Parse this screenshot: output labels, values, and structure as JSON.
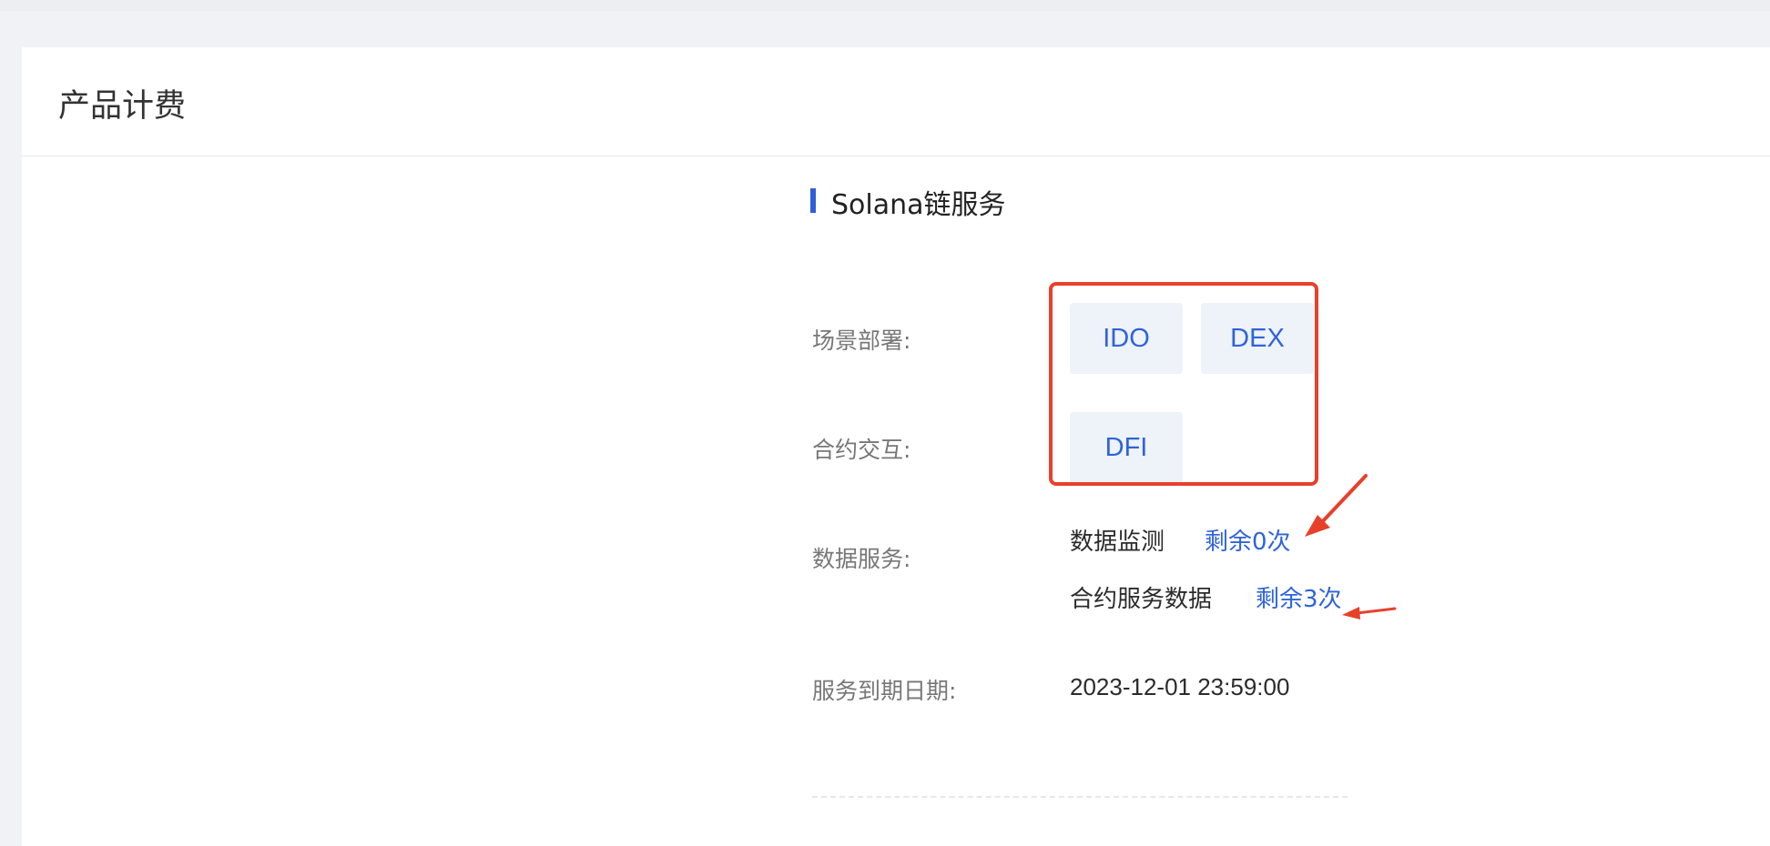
{
  "page": {
    "title": "产品计费"
  },
  "section": {
    "title": "Solana链服务"
  },
  "fields": {
    "scene_label": "场景部署:",
    "contract_label": "合约交互:",
    "data_label": "数据服务:",
    "expiry_label": "服务到期日期:"
  },
  "scene_chips": [
    "IDO",
    "DEX"
  ],
  "contract_chips": [
    "DFI"
  ],
  "data_services": [
    {
      "name": "数据监测",
      "remaining": "剩余0次"
    },
    {
      "name": "合约服务数据",
      "remaining": "剩余3次"
    }
  ],
  "expiry": {
    "value": "2023-12-01 23:59:00"
  },
  "colors": {
    "accent": "#2f63d9",
    "annotation": "#e8402b",
    "chip_bg": "#eef2f9"
  }
}
